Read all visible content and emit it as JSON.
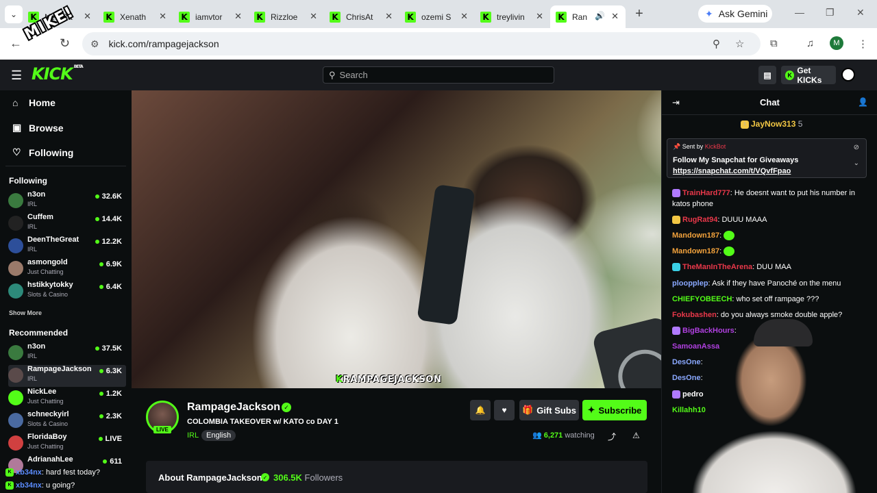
{
  "browser": {
    "tabs": [
      {
        "title": "NerdBa"
      },
      {
        "title": "Xenath"
      },
      {
        "title": "iamvtor"
      },
      {
        "title": "Rizzloe"
      },
      {
        "title": "ChrisAt"
      },
      {
        "title": "ozemi S"
      },
      {
        "title": "treylivin"
      },
      {
        "title": "Ran"
      }
    ],
    "gemini_label": "Ask Gemini",
    "url": "kick.com/rampagejackson",
    "profile_initial": "M",
    "sticker_text": "MIKE!"
  },
  "kick": {
    "logo": "KICK",
    "beta": "BETA",
    "search_placeholder": "Search",
    "get_kicks": "Get KICKs",
    "nav": {
      "home": "Home",
      "browse": "Browse",
      "following": "Following"
    },
    "following_header": "Following",
    "following": [
      {
        "name": "n3on",
        "category": "IRL",
        "viewers": "32.6K",
        "color": "#3a7a3f"
      },
      {
        "name": "Cuffem",
        "category": "IRL",
        "viewers": "14.4K",
        "color": "#222"
      },
      {
        "name": "DeenTheGreat",
        "category": "IRL",
        "viewers": "12.2K",
        "color": "#2d4f9a"
      },
      {
        "name": "asmongold",
        "category": "Just Chatting",
        "viewers": "6.9K",
        "color": "#9a7a6a"
      },
      {
        "name": "hstikkytokky",
        "category": "Slots & Casino",
        "viewers": "6.4K",
        "color": "#2d8a7a"
      }
    ],
    "show_more": "Show More",
    "recommended_header": "Recommended",
    "recommended": [
      {
        "name": "n3on",
        "category": "IRL",
        "viewers": "37.5K",
        "color": "#3a7a3f"
      },
      {
        "name": "RampageJackson",
        "category": "IRL",
        "viewers": "6.3K",
        "color": "#5a4a4a"
      },
      {
        "name": "NickLee",
        "category": "Just Chatting",
        "viewers": "1.2K",
        "color": "#53fc18"
      },
      {
        "name": "schneckyirl",
        "category": "Slots & Casino",
        "viewers": "2.3K",
        "color": "#4a6aa0"
      },
      {
        "name": "FloridaBoy",
        "category": "Just Chatting",
        "viewers": "LIVE",
        "color": "#d04040"
      },
      {
        "name": "AdrianahLee",
        "category": "",
        "viewers": "611",
        "color": "#b07a9a"
      }
    ]
  },
  "stream": {
    "video_tag": "RAMPAGEJACKSON",
    "channel": "RampageJackson",
    "live": "LIVE",
    "title": "COLOMBIA TAKEOVER w/ KATO co  DAY 1",
    "category": "IRL",
    "language": "English",
    "gift_subs": "Gift Subs",
    "subscribe": "Subscribe",
    "watching_count": "6,271",
    "watching_label": "watching",
    "about": "About RampageJackson",
    "followers_count": "306.5K",
    "followers_label": "Followers"
  },
  "chat": {
    "title": "Chat",
    "gifter": {
      "name": "JayNow313",
      "count": "5"
    },
    "pinned": {
      "sent_by": "Sent by",
      "bot": "KickBot",
      "message": "Follow My Snapchat for Giveaways",
      "link": "https://snapchat.com/t/VQvfFpao"
    },
    "messages": [
      {
        "user": "TrainHard777",
        "color": "#e9384a",
        "text": "He doesnt want to put his number in katos phone",
        "badge": "#b07aff"
      },
      {
        "user": "RugRat94",
        "color": "#e9384a",
        "text": "DUUU MAAA",
        "badge": "#f2c744"
      },
      {
        "user": "Mandown187",
        "color": "#f2a23c",
        "text": "",
        "badge": ""
      },
      {
        "user": "Mandown187",
        "color": "#f2a23c",
        "text": "",
        "badge": ""
      },
      {
        "user": "TheManInTheArena",
        "color": "#e9384a",
        "text": "DUU MAA",
        "badge": "#3ad0e6"
      },
      {
        "user": "ploopplep",
        "color": "#8aa8ff",
        "text": "Ask if they have Panoché on the menu",
        "badge": ""
      },
      {
        "user": "CHIEFYOBEECH",
        "color": "#53fc18",
        "text": "who set off rampage ???",
        "badge": ""
      },
      {
        "user": "Fokubashen",
        "color": "#e9384a",
        "text": "do you always smoke double apple?",
        "badge": ""
      },
      {
        "user": "BigBackHours",
        "color": "#b040e0",
        "text": "",
        "badge": "#b07aff"
      },
      {
        "user": "SamoanAssa",
        "color": "#b040e0",
        "text": "",
        "badge": ""
      },
      {
        "user": "DesOne",
        "color": "#8aa8ff",
        "text": "",
        "badge": ""
      },
      {
        "user": "DesOne",
        "color": "#8aa8ff",
        "text": "",
        "badge": ""
      },
      {
        "user": "pedro",
        "color": "#fff",
        "text": "",
        "badge": "#b07aff"
      },
      {
        "user": "Killahh10",
        "color": "#53fc18",
        "text": "",
        "badge": ""
      }
    ]
  },
  "overlay_chat": [
    {
      "user": "xb34nx",
      "text": "hard fest today?"
    },
    {
      "user": "xb34nx",
      "text": "u going?"
    }
  ],
  "colors": {
    "accent": "#53fc18",
    "header": "#191b1f",
    "background": "#0b0e0f"
  }
}
